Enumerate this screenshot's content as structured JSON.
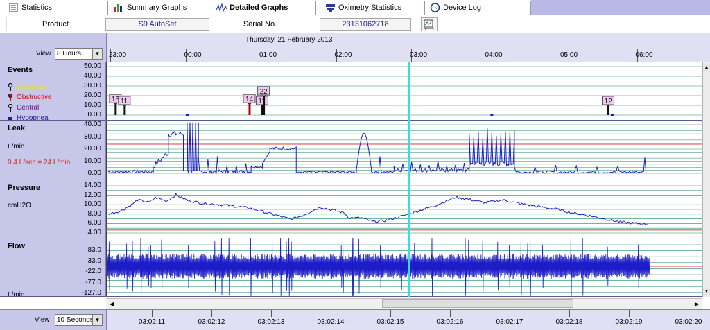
{
  "tabs": [
    {
      "label": "Statistics",
      "icon": "statistics-icon",
      "active": false
    },
    {
      "label": "Summary Graphs",
      "icon": "bar-chart-icon",
      "active": false
    },
    {
      "label": "Detailed Graphs",
      "icon": "waveform-icon",
      "active": true
    },
    {
      "label": "Oximetry Statistics",
      "icon": "oximetry-icon",
      "active": false
    },
    {
      "label": "Device Log",
      "icon": "clock-icon",
      "active": false
    }
  ],
  "info": {
    "product_label": "Product",
    "product_value": "S9 AutoSet",
    "serial_label": "Serial No.",
    "serial_value": "23131062718"
  },
  "header": {
    "date": "Thursday, 21 February 2013",
    "view_label": "View",
    "view_value": "8 Hours",
    "time_ticks": [
      "23:00",
      "00:00",
      "01:00",
      "02:00",
      "03:00",
      "04:00",
      "05:00",
      "06:00"
    ]
  },
  "events_panel": {
    "title": "Events",
    "y_labels": [
      "50.00",
      "40.00",
      "30.00",
      "20.00",
      "10.00",
      "0.00"
    ],
    "legend": [
      {
        "label": "Unknown",
        "color": "#e8e800"
      },
      {
        "label": "Obstructive",
        "color": "#e00000"
      },
      {
        "label": "Central",
        "color": "#6a0a8a"
      },
      {
        "label": "Hypopnea",
        "color": "#1c1c9c"
      }
    ],
    "markers": [
      {
        "label": "13",
        "hour": 0.1,
        "y": 17
      },
      {
        "label": "11",
        "hour": 0.22,
        "y": 15
      },
      {
        "label": "14",
        "hour": 1.88,
        "y": 17
      },
      {
        "label": "11",
        "hour": 2.05,
        "y": 15
      },
      {
        "label": "22",
        "hour": 2.07,
        "y": 25
      },
      {
        "label": "12",
        "hour": 6.65,
        "y": 15
      }
    ]
  },
  "leak_panel": {
    "title": "Leak",
    "unit": "L/min",
    "threshold_note": "0.4 L/sec = 24 L/min",
    "threshold_value": 24,
    "y_labels": [
      "40.00",
      "30.00",
      "20.00",
      "10.00",
      "0.00"
    ]
  },
  "pressure_panel": {
    "title": "Pressure",
    "unit": "cmH2O",
    "y_labels": [
      "14.00",
      "12.00",
      "10.00",
      "8.00",
      "6.00",
      "4.00"
    ]
  },
  "flow_panel": {
    "title": "Flow",
    "unit": "L/min",
    "y_labels": [
      "83.0",
      "33.0",
      "-22.0",
      "-77.0",
      "-127.0"
    ]
  },
  "footer": {
    "view_label": "View",
    "view_value": "10 Seconds",
    "second_ticks": [
      "03:02:11",
      "03:02:12",
      "03:02:13",
      "03:02:14",
      "03:02:15",
      "03:02:16",
      "03:02:17",
      "03:02:18",
      "03:02:19",
      "03:02:20"
    ]
  },
  "colors": {
    "trace": "#1c1cc8",
    "threshold_line": "#e04040",
    "grid": "#1f8a6a",
    "cursor": "#2fe0ea",
    "panel_bg": "#c7c7ea"
  },
  "icons": {
    "scroll_up": "▲",
    "scroll_down": "▼",
    "scroll_left": "◀",
    "scroll_right": "▶",
    "dropdown": "▼",
    "graph_settings": "graph-settings-icon"
  }
}
